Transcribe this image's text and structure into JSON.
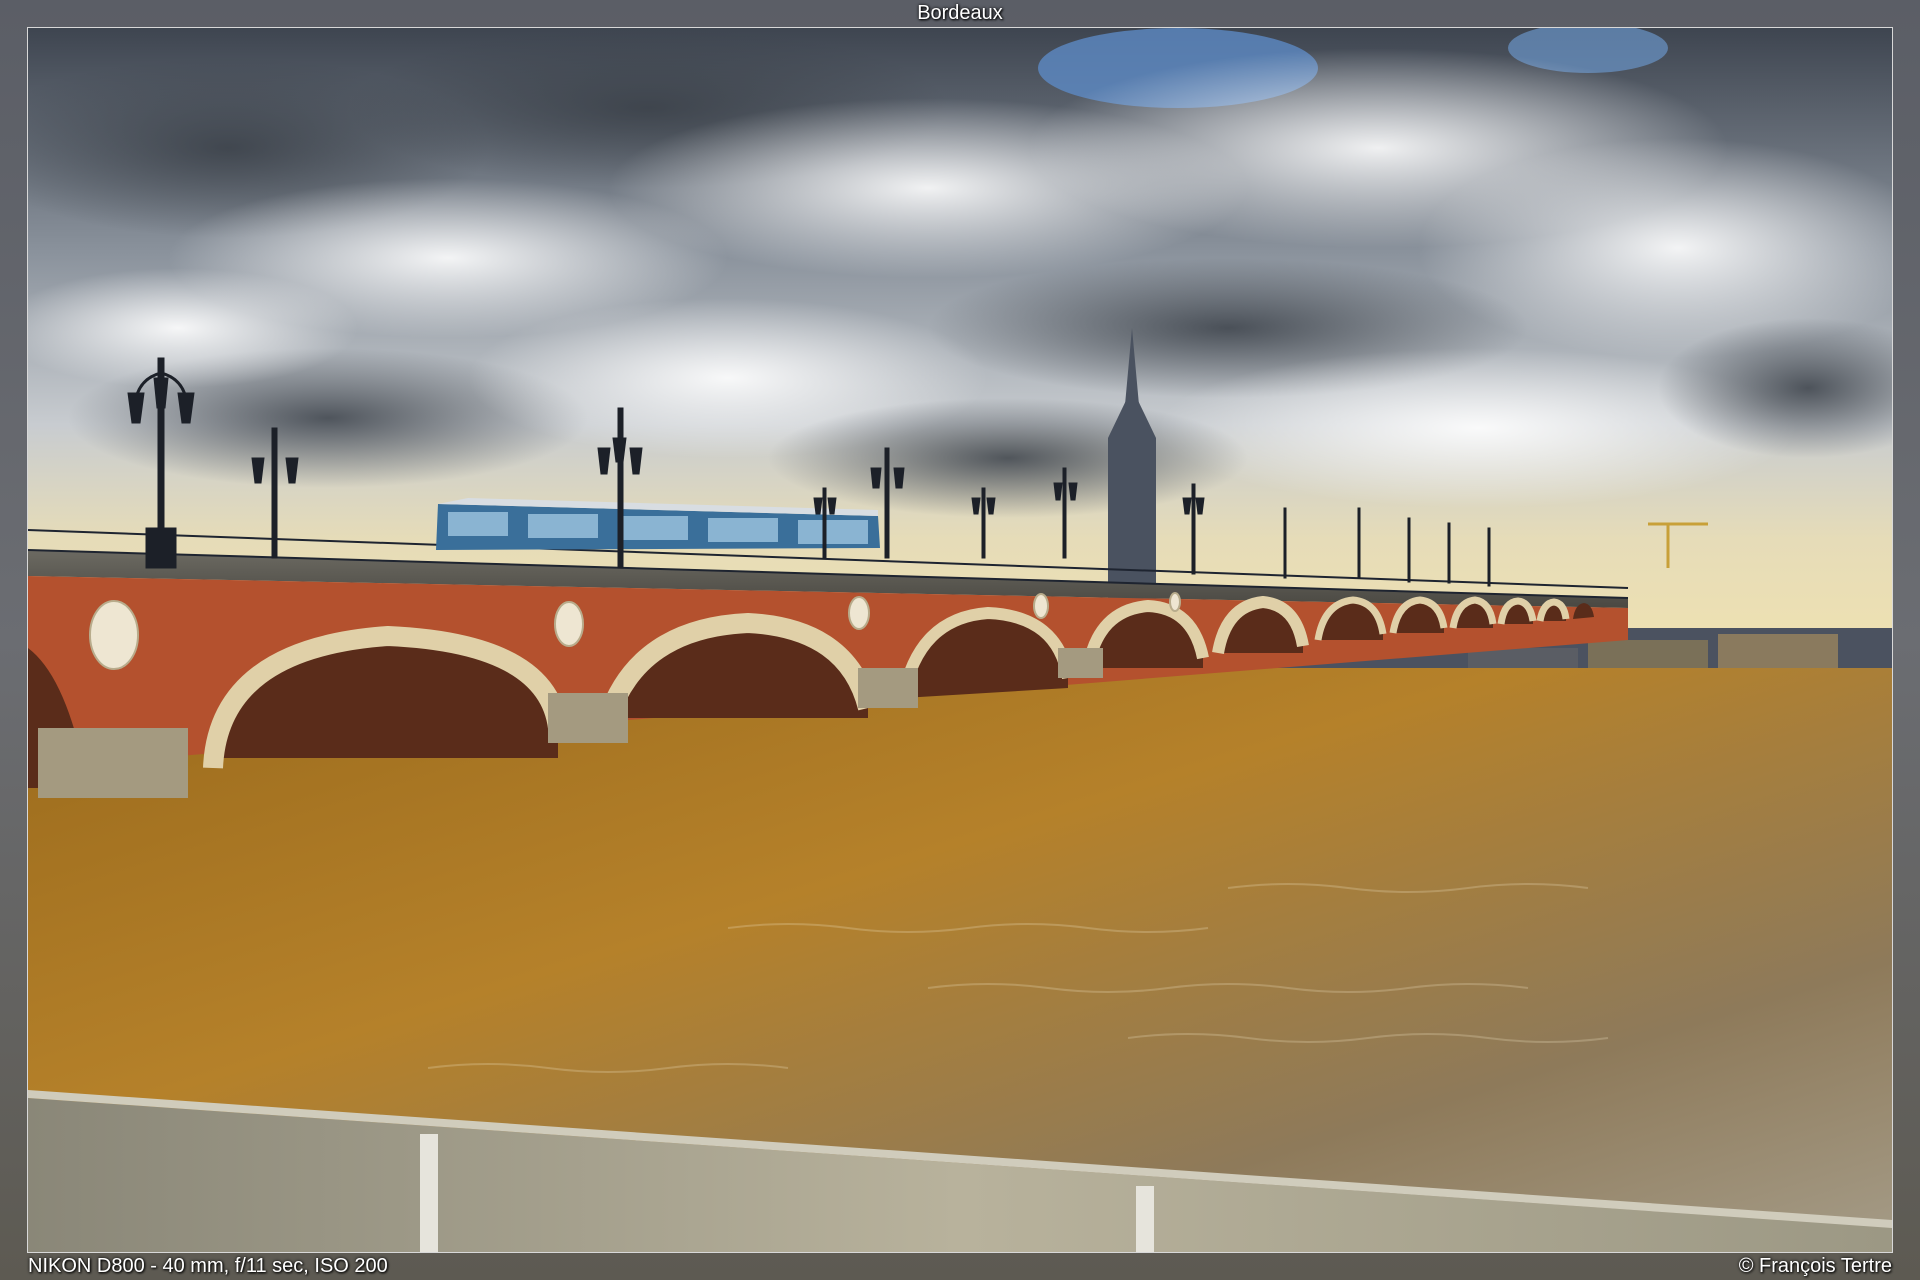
{
  "title": "Bordeaux",
  "camera_info": "NIKON D800 - 40 mm, f/11 sec, ISO 200",
  "copyright": "© François Tertre",
  "colors": {
    "sky_top": "#3f4550",
    "sky_horizon": "#e8d9a8",
    "brick": "#b5502d",
    "stone": "#e3d2ad",
    "water": "#a8741e",
    "tram": "#3a6f9a"
  }
}
